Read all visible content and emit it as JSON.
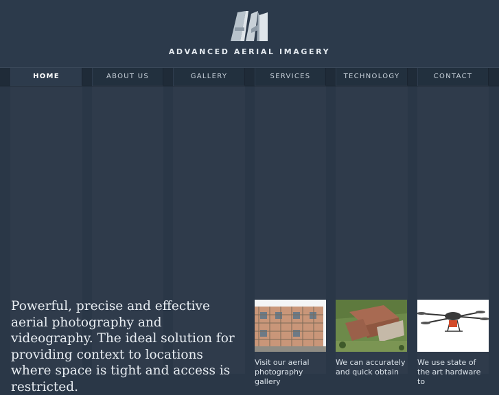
{
  "brand": {
    "name": "ADVANCED AERIAL IMAGERY"
  },
  "nav": {
    "items": [
      {
        "label": "HOME",
        "active": true
      },
      {
        "label": "ABOUT US",
        "active": false
      },
      {
        "label": "GALLERY",
        "active": false
      },
      {
        "label": "SERVICES",
        "active": false
      },
      {
        "label": "TECHNOLOGY",
        "active": false
      },
      {
        "label": "CONTACT",
        "active": false
      }
    ]
  },
  "hero": {
    "tagline": "Powerful, precise and effective aerial photography and videography. The ideal solution for providing context to locations where space is tight and access is restricted."
  },
  "features": [
    {
      "image": "scaffolded-building-photo",
      "caption": "Visit our aerial photography gallery"
    },
    {
      "image": "farm-buildings-aerial-photo",
      "caption": "We can accurately and quick obtain"
    },
    {
      "image": "hexacopter-drone-photo",
      "caption": "We use state of the art hardware to"
    }
  ],
  "colors": {
    "background": "#2a3747",
    "nav": "#1f2b38",
    "nav_active": "#2d3b4c",
    "text": "#e8edf2"
  }
}
